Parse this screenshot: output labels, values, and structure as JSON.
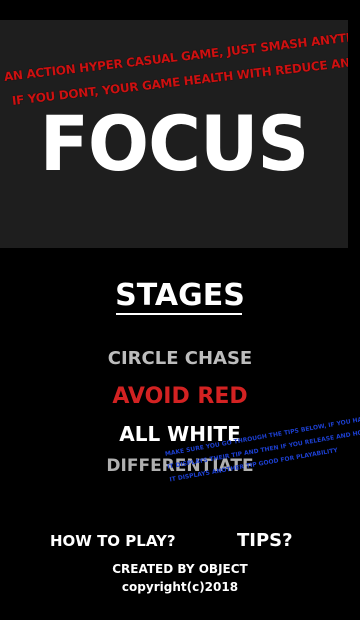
{
  "banner": {
    "tagline_line1": "AN ACTION HYPER CASUAL GAME, JUST SMASH ANYTHING WHITE!!!",
    "tagline_line2": "IF YOU DONT, YOUR GAME HEALTH WITH REDUCE AND THE GAMEOVER",
    "title": "FOCUS"
  },
  "stages": {
    "heading": "STAGES",
    "items": [
      {
        "label": "CIRCLE CHASE",
        "color": "#bdbdbd"
      },
      {
        "label": "AVOID RED",
        "color": "#d32222"
      },
      {
        "label": "ALL WHITE",
        "color": "#ffffff"
      },
      {
        "label": "DIFFERENTIATE",
        "color": "#b0b0b0"
      }
    ]
  },
  "tip": {
    "lines": [
      "MAKE SURE YOU GO THROUGH THE TIPS BELOW, IF YOU HAVE DOWN ON IT",
      "IT DISPLAYS THEIR TIP AND THEN IF YOU RELEASE AND HOLD IT AGAIN",
      "IT DISPLAYS ANOTHER TIP GOOD FOR PLAYABILITY"
    ],
    "color": "#1c3fd0"
  },
  "footer": {
    "how_to_play": "HOW  TO PLAY?",
    "tips": "TIPS?",
    "credit": "CREATED BY OBJECT",
    "copyright": "copyright(c)2018"
  },
  "colors": {
    "background": "#000000",
    "banner_background": "#1e1e1e",
    "tagline_red": "#cc1111",
    "accent_red": "#d32222"
  }
}
